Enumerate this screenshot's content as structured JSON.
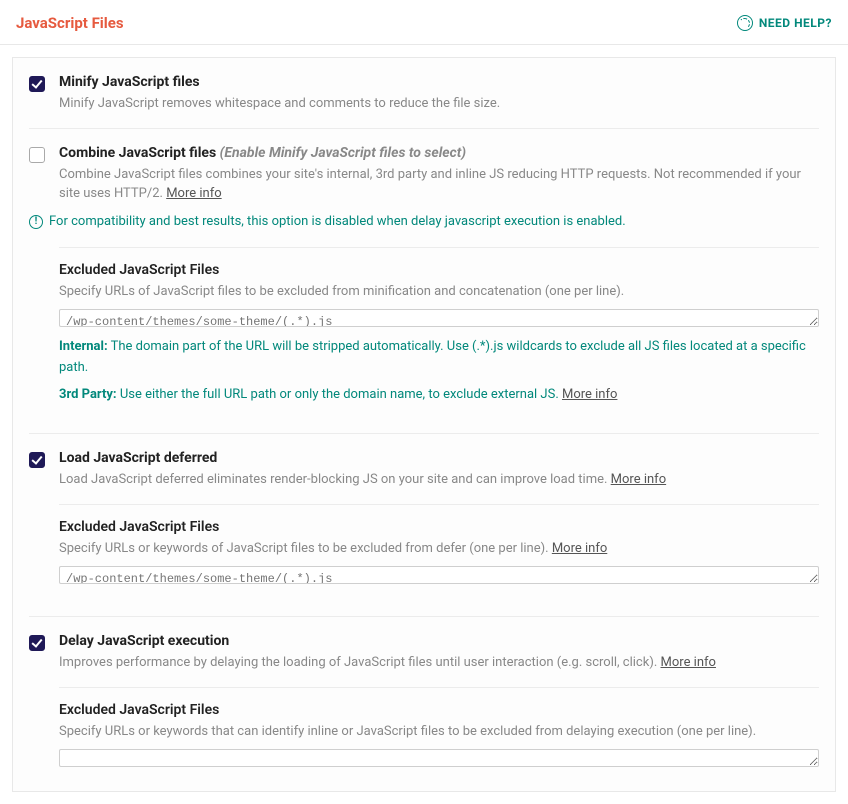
{
  "header": {
    "title": "JavaScript Files",
    "help": "NEED HELP?"
  },
  "minify": {
    "title": "Minify JavaScript files",
    "desc": "Minify JavaScript removes whitespace and comments to reduce the file size."
  },
  "combine": {
    "title": "Combine JavaScript files",
    "hint": "(Enable Minify JavaScript files to select)",
    "desc": "Combine JavaScript files combines your site's internal, 3rd party and inline JS reducing HTTP requests. Not recommended if your site uses HTTP/2. ",
    "more": "More info",
    "notice": "For compatibility and best results, this option is disabled when delay javascript execution is enabled."
  },
  "excluded1": {
    "title": "Excluded JavaScript Files",
    "desc": "Specify URLs of JavaScript files to be excluded from minification and concatenation (one per line).",
    "placeholder": "/wp-content/themes/some-theme/(.*).js",
    "note_internal_label": "Internal:",
    "note_internal_text": " The domain part of the URL will be stripped automatically. Use (.*).js wildcards to exclude all JS files located at a specific path.",
    "note_3rd_label": "3rd Party:",
    "note_3rd_text": " Use either the full URL path or only the domain name, to exclude external JS. ",
    "more": "More info"
  },
  "defer": {
    "title": "Load JavaScript deferred",
    "desc": "Load JavaScript deferred eliminates render-blocking JS on your site and can improve load time. ",
    "more": "More info"
  },
  "excluded2": {
    "title": "Excluded JavaScript Files",
    "desc": "Specify URLs or keywords of JavaScript files to be excluded from defer (one per line). ",
    "more": "More info",
    "placeholder": "/wp-content/themes/some-theme/(.*).js"
  },
  "delay": {
    "title": "Delay JavaScript execution",
    "desc": "Improves performance by delaying the loading of JavaScript files until user interaction (e.g. scroll, click). ",
    "more": "More info"
  },
  "excluded3": {
    "title": "Excluded JavaScript Files",
    "desc": "Specify URLs or keywords that can identify inline or JavaScript files to be excluded from delaying execution (one per line)."
  }
}
